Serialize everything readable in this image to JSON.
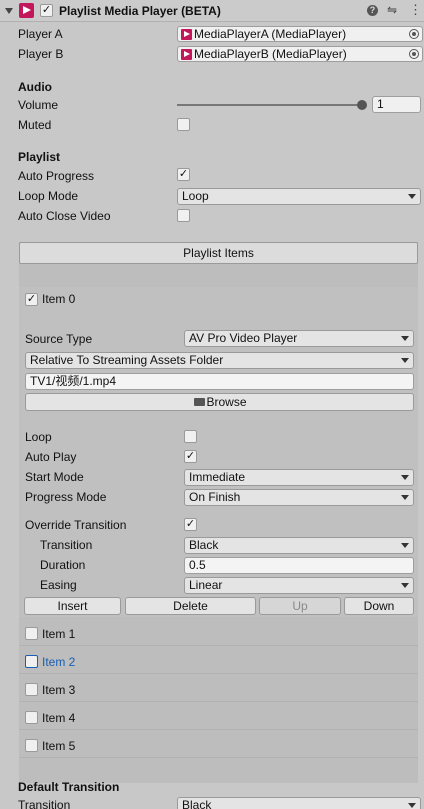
{
  "header": {
    "title": "Playlist Media Player (BETA)",
    "enabled": true,
    "icons": [
      "collapse-arrow-icon",
      "component-icon",
      "help-icon",
      "presets-icon",
      "context-menu-icon"
    ]
  },
  "players": {
    "player_a_label": "Player A",
    "player_a_value": "MediaPlayerA (MediaPlayer)",
    "player_b_label": "Player B",
    "player_b_value": "MediaPlayerB (MediaPlayer)"
  },
  "audio": {
    "title": "Audio",
    "volume_label": "Volume",
    "volume_value": "1",
    "volume_fraction": 1.0,
    "muted_label": "Muted",
    "muted": false
  },
  "playlist": {
    "title": "Playlist",
    "auto_progress_label": "Auto Progress",
    "auto_progress": true,
    "loop_mode_label": "Loop Mode",
    "loop_mode_value": "Loop",
    "auto_close_label": "Auto Close Video",
    "auto_close": false
  },
  "playlist_items": {
    "header_label": "Playlist Items",
    "item0": {
      "label": "Item 0",
      "checked": true,
      "source_type_label": "Source Type",
      "source_type_value": "AV Pro Video Player",
      "path_type_value": "Relative To Streaming Assets Folder",
      "path_value": "TV1/视频/1.mp4",
      "browse_label": "Browse",
      "loop_label": "Loop",
      "loop": false,
      "auto_play_label": "Auto Play",
      "auto_play": true,
      "start_mode_label": "Start Mode",
      "start_mode_value": "Immediate",
      "progress_mode_label": "Progress Mode",
      "progress_mode_value": "On Finish",
      "override_transition_label": "Override Transition",
      "override_transition": true,
      "transition_label": "Transition",
      "transition_value": "Black",
      "duration_label": "Duration",
      "duration_value": "0.5",
      "easing_label": "Easing",
      "easing_value": "Linear",
      "insert_label": "Insert",
      "delete_label": "Delete",
      "up_label": "Up",
      "down_label": "Down"
    },
    "items": [
      {
        "label": "Item 1",
        "highlighted": false
      },
      {
        "label": "Item 2",
        "highlighted": true
      },
      {
        "label": "Item 3",
        "highlighted": false
      },
      {
        "label": "Item 4",
        "highlighted": false
      },
      {
        "label": "Item 5",
        "highlighted": false
      }
    ]
  },
  "default_transition": {
    "title": "Default Transition",
    "transition_label": "Transition",
    "transition_value": "Black"
  },
  "colors": {
    "background": "#c8c8c8",
    "panel": "#bdbdbd",
    "highlight_text": "#1a5fb4",
    "media_icon": "#c2185b"
  }
}
